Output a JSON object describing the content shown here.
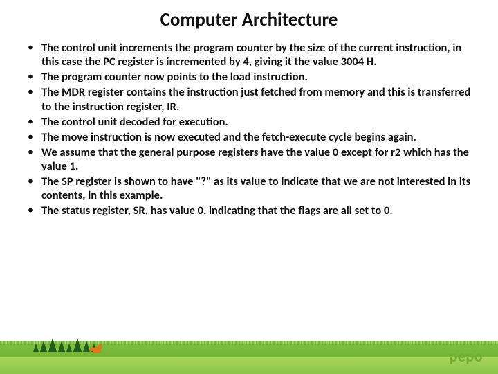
{
  "title": "Computer Architecture",
  "bullets": [
    "The control unit increments the program counter by the size of the current instruction, in this case the PC register is incremented by 4, giving it the value 3004 H.",
    "The program counter now points to the load instruction.",
    "The MDR register  contains the instruction just fetched from memory and this is transferred to the instruction register, IR.",
    "The control unit  decoded for execution.",
    "The move instruction is now executed and the fetch-execute cycle begins again.",
    "We assume that the general purpose registers have the value 0 except for r2 which has the value 1.",
    "The SP register is shown to have \"?\" as its value to indicate that we are not interested in its contents, in this example.",
    "The status register, SR, has value 0, indicating that the flags are all set to 0."
  ],
  "brand": "pepo"
}
